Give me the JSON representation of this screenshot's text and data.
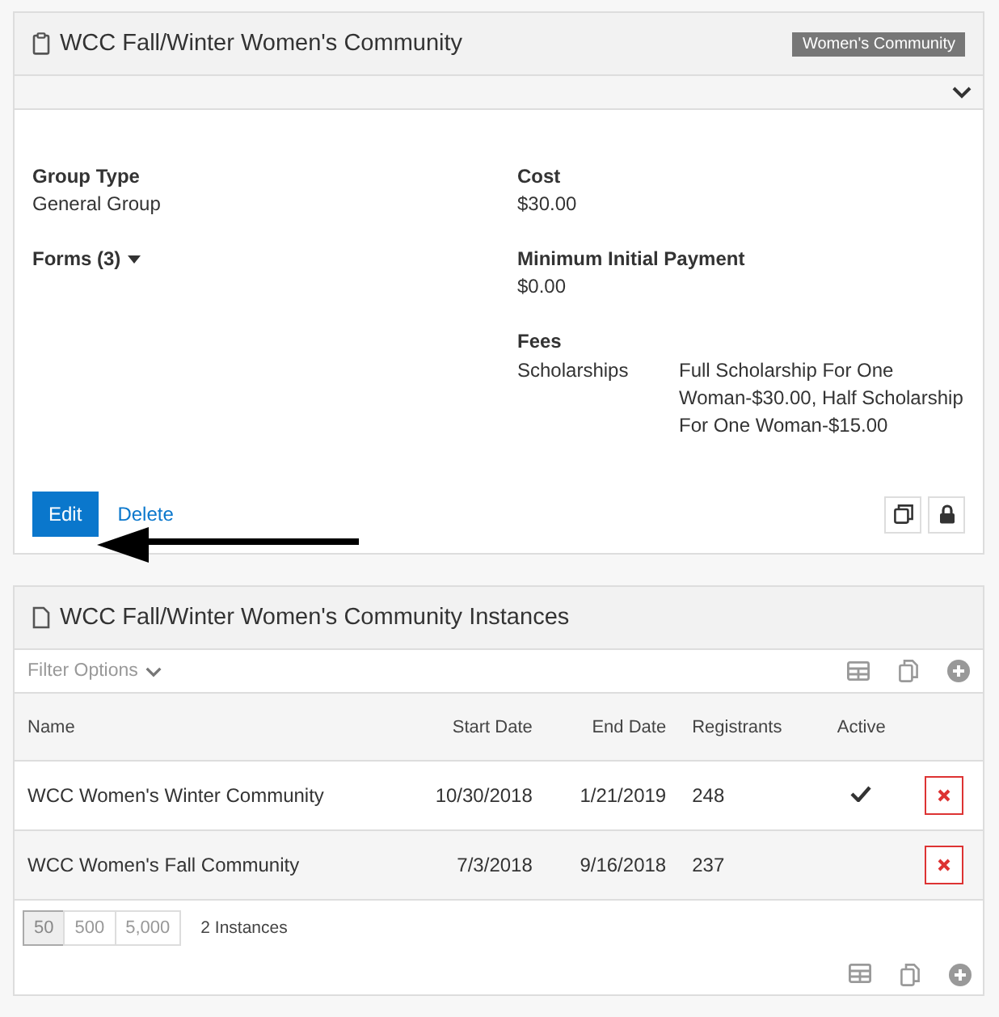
{
  "group": {
    "title": "WCC Fall/Winter Women's Community",
    "tag": "Women's Community",
    "expanded": false,
    "left_details": [
      {
        "label": "Group Type",
        "value": "General Group",
        "kind": "field"
      },
      {
        "label": "Forms (3)",
        "kind": "dropdown"
      }
    ],
    "right_details": [
      {
        "label": "Cost",
        "value": "$30.00",
        "kind": "field"
      },
      {
        "label": "Minimum Initial Payment",
        "value": "$0.00",
        "kind": "field"
      }
    ],
    "fees": {
      "label": "Fees",
      "name": "Scholarships",
      "value": "Full Scholarship For One Woman-$30.00, Half Scholarship For One Woman-$15.00"
    },
    "edit_button": "Edit",
    "delete_link": "Delete"
  },
  "instances": {
    "title": "WCC Fall/Winter Women's Community Instances",
    "filter": "Filter Options",
    "columns": [
      "Name",
      "Start Date",
      "End Date",
      "Registrants",
      "Active"
    ],
    "rows": [
      {
        "name": "WCC Women's Winter Community",
        "start": "10/30/2018",
        "end": "1/21/2019",
        "registrants": "248",
        "active": true
      },
      {
        "name": "WCC Women's Fall Community",
        "start": "7/3/2018",
        "end": "9/16/2018",
        "registrants": "237",
        "active": false
      }
    ],
    "page_sizes": [
      {
        "label": "50",
        "selected": true
      },
      {
        "label": "500",
        "selected": false
      },
      {
        "label": "5,000",
        "selected": false
      }
    ],
    "count": "2 Instances"
  }
}
